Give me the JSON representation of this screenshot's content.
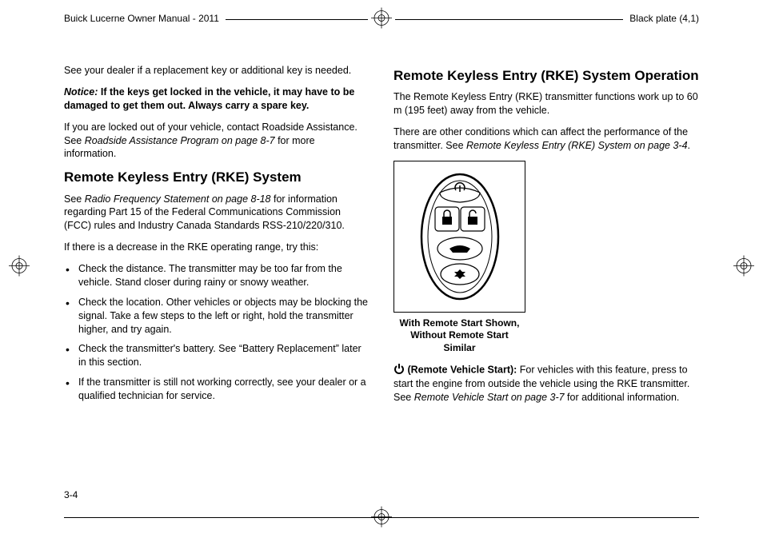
{
  "header": {
    "left": "Buick Lucerne Owner Manual - 2011",
    "right": "Black plate (4,1)"
  },
  "page_number": "3-4",
  "left_col": {
    "p1": "See your dealer if a replacement key or additional key is needed.",
    "notice_label": "Notice:",
    "notice_text": " If the keys get locked in the vehicle, it may have to be damaged to get them out. Always carry a spare key.",
    "p3a": "If you are locked out of your vehicle, contact Roadside Assistance. See ",
    "p3b": "Roadside Assistance Program on page 8‑7",
    "p3c": " for more information.",
    "h1": "Remote Keyless Entry (RKE) System",
    "p4a": "See ",
    "p4b": "Radio Frequency Statement on page 8‑18",
    "p4c": " for information regarding Part 15 of the Federal Communications Commission (FCC) rules and Industry Canada Standards RSS-210/220/310.",
    "p5": "If there is a decrease in the RKE operating range, try this:",
    "bullets": {
      "b1": "Check the distance. The transmitter may be too far from the vehicle. Stand closer during rainy or snowy weather.",
      "b2": "Check the location. Other vehicles or objects may be blocking the signal. Take a few steps to the left or right, hold the transmitter higher, and try again.",
      "b3": "Check the transmitter's battery. See “Battery Replacement” later in this section.",
      "b4": "If the transmitter is still not working correctly, see your dealer or a qualified technician for service."
    }
  },
  "right_col": {
    "h1": "Remote Keyless Entry (RKE) System Operation",
    "p1": "The Remote Keyless Entry (RKE) transmitter functions work up to 60 m (195 feet) away from the vehicle.",
    "p2a": "There are other conditions which can affect the performance of the transmitter. See ",
    "p2b": "Remote Keyless Entry (RKE) System on page 3‑4",
    "p2c": ".",
    "caption": "With Remote Start Shown, Without Remote Start Similar",
    "remote_label": " (Remote Vehicle Start):",
    "remote_text_a": " For vehicles with this feature, press to start the engine from outside the vehicle using the RKE transmitter. See ",
    "remote_text_b": "Remote Vehicle Start on page 3‑7",
    "remote_text_c": " for additional information."
  }
}
